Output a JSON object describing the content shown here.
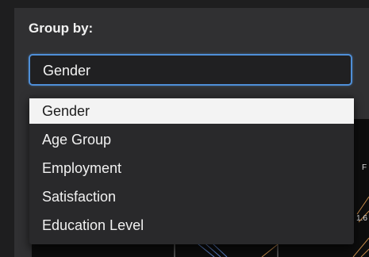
{
  "group_by": {
    "label": "Group by:",
    "selected": "Gender",
    "options": [
      "Gender",
      "Age Group",
      "Employment",
      "Satisfaction",
      "Education Level"
    ]
  },
  "chart_fragment": {
    "tick_f": "F",
    "tick_value": "1.6"
  },
  "colors": {
    "accent": "#4f8fd8",
    "panel": "#303032",
    "dropdown": "#29292b",
    "selected_option_bg": "#f3f3f3"
  }
}
